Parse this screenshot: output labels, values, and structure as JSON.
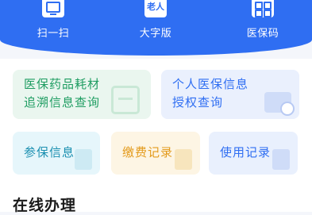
{
  "quick_actions": [
    {
      "label": "扫一扫",
      "icon": "scan-icon"
    },
    {
      "label": "大字版",
      "icon": "elderly-mode-icon",
      "icon_text": "老人"
    },
    {
      "label": "医保码",
      "icon": "insurance-code-icon"
    }
  ],
  "cards": {
    "drug_trace": {
      "line1": "医保药品耗材",
      "line2": "追溯信息查询"
    },
    "authorization": {
      "line1": "个人医保信息",
      "line2": "授权查询"
    },
    "insurance_info": {
      "label": "参保信息"
    },
    "payment_records": {
      "label": "缴费记录"
    },
    "usage_records": {
      "label": "使用记录"
    }
  },
  "section": {
    "title": "在线办理"
  },
  "colors": {
    "brand_blue": "#2f6ef2",
    "green": "#1f9d62",
    "orange": "#e39a1b",
    "teal": "#1a8fb0"
  }
}
